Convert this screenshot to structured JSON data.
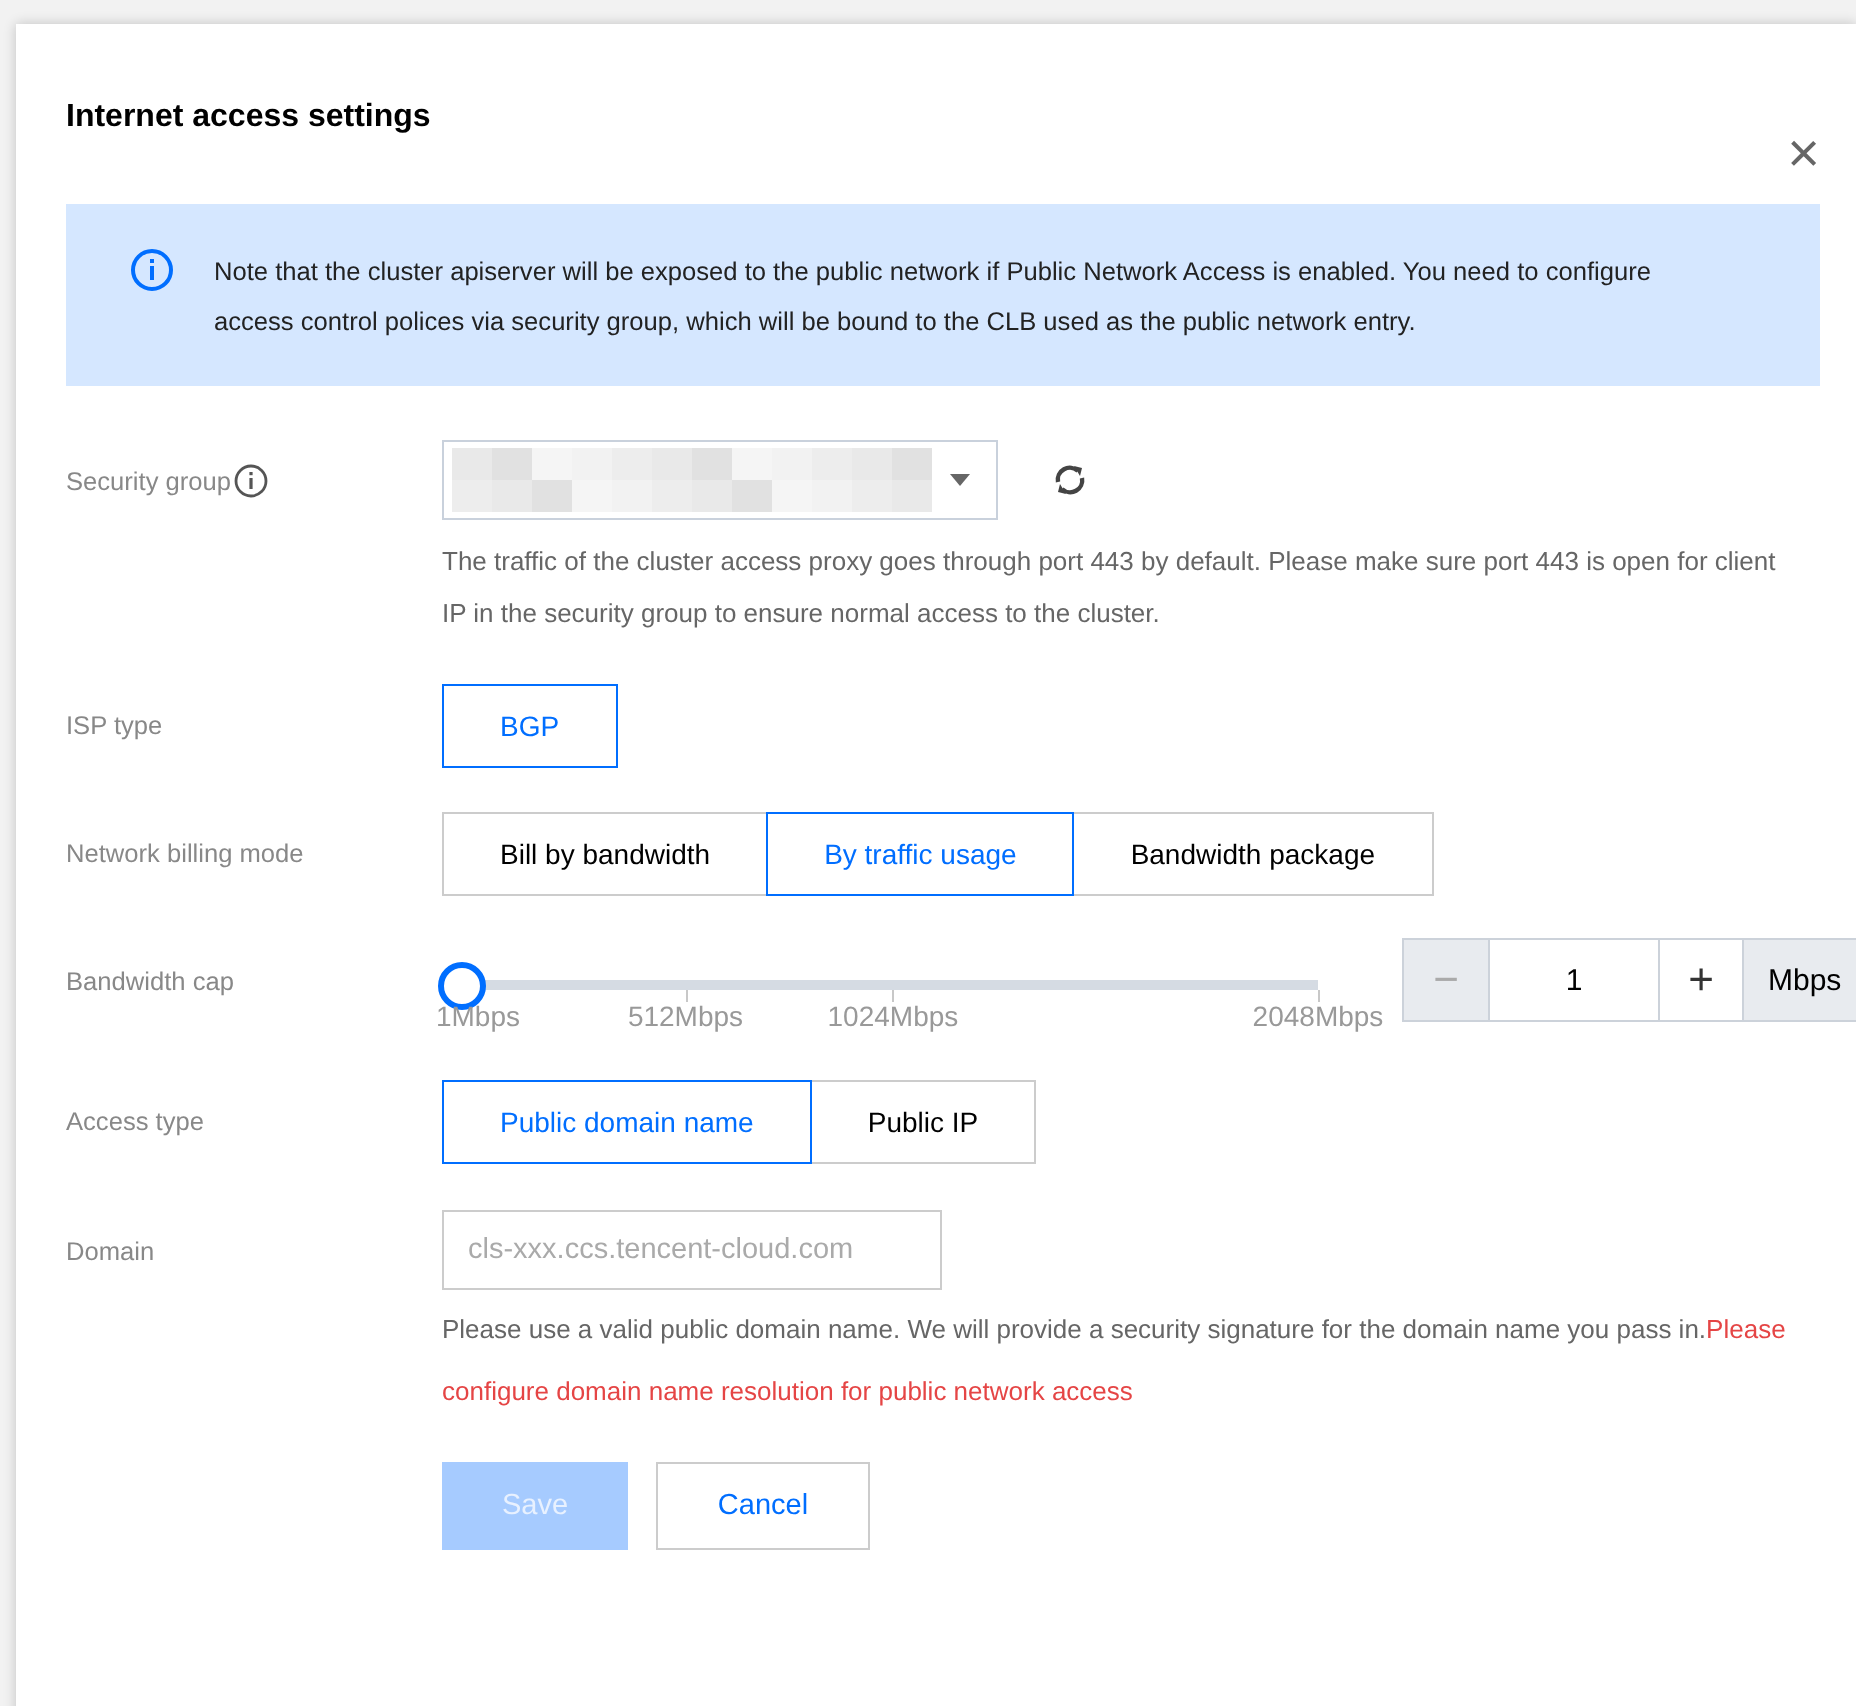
{
  "dialog": {
    "title": "Internet access settings",
    "close": "×"
  },
  "notice": {
    "text": "Note that the cluster apiserver will be exposed to the public network if Public Network Access is enabled. You need to configure access control polices via security group, which will be bound to the CLB used as the public network entry."
  },
  "security_group": {
    "label": "Security group",
    "hint": "The traffic of the cluster access proxy goes through port 443 by default. Please make sure port 443 is open for client IP in the security group to ensure normal access to the cluster."
  },
  "isp_type": {
    "label": "ISP type",
    "options": [
      {
        "label": "BGP",
        "selected": true
      }
    ]
  },
  "billing_mode": {
    "label": "Network billing mode",
    "options": [
      {
        "label": "Bill by bandwidth",
        "selected": false
      },
      {
        "label": "By traffic usage",
        "selected": true
      },
      {
        "label": "Bandwidth package",
        "selected": false
      }
    ]
  },
  "bandwidth_cap": {
    "label": "Bandwidth cap",
    "level": 0,
    "ticks": [
      "1Mbps",
      "512Mbps",
      "1024Mbps",
      "2048Mbps"
    ],
    "minus": "−",
    "value": "1",
    "plus": "+",
    "unit": "Mbps"
  },
  "access_type": {
    "label": "Access type",
    "options": [
      {
        "label": "Public domain name",
        "selected": true
      },
      {
        "label": "Public IP",
        "selected": false
      }
    ]
  },
  "domain": {
    "label": "Domain",
    "placeholder": "cls-xxx.ccs.tencent-cloud.com",
    "hint": "Please use a valid public domain name. We will provide a security signature for the domain name you pass in.",
    "warning": "Please configure domain name resolution for public network access"
  },
  "buttons": [
    {
      "label": "Save",
      "kind": "primary",
      "disabled": true
    },
    {
      "label": "Cancel",
      "kind": "secondary",
      "disabled": false
    }
  ]
}
